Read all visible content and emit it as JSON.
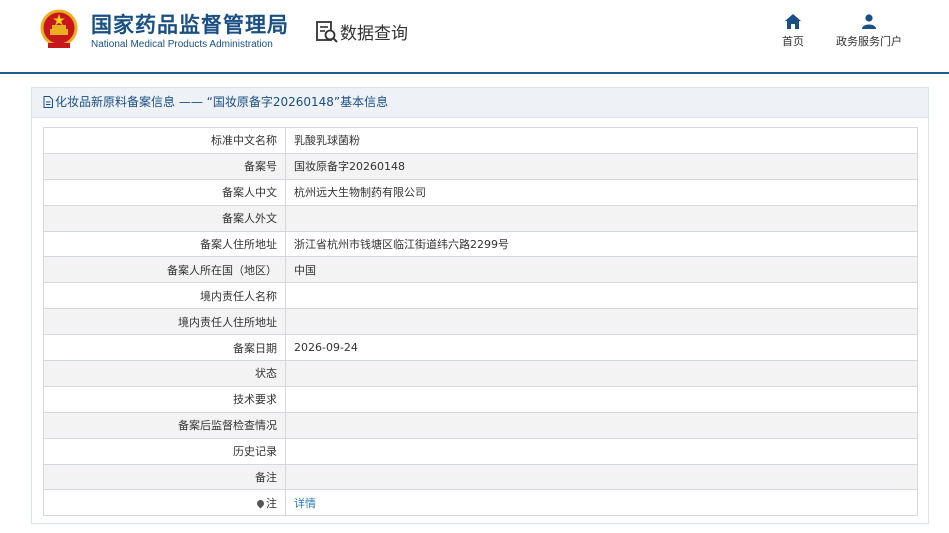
{
  "header": {
    "agency_cn": "国家药品监督管理局",
    "agency_en": "National Medical Products Administration",
    "query_title": "数据查询",
    "nav": [
      {
        "label": "首页",
        "icon": "home-icon"
      },
      {
        "label": "政务服务门户",
        "icon": "user-icon"
      }
    ]
  },
  "panel": {
    "title": "化妆品新原料备案信息 —— “国妆原备字20260148”基本信息",
    "rows": [
      {
        "label": "标准中文名称",
        "value": "乳酸乳球菌粉"
      },
      {
        "label": "备案号",
        "value": "国妆原备字20260148"
      },
      {
        "label": "备案人中文",
        "value": "杭州远大生物制药有限公司"
      },
      {
        "label": "备案人外文",
        "value": ""
      },
      {
        "label": "备案人住所地址",
        "value": "浙江省杭州市钱塘区临江街道纬六路2299号"
      },
      {
        "label": "备案人所在国（地区）",
        "value": "中国"
      },
      {
        "label": "境内责任人名称",
        "value": ""
      },
      {
        "label": "境内责任人住所地址",
        "value": ""
      },
      {
        "label": "备案日期",
        "value": "2026-09-24"
      },
      {
        "label": "状态",
        "value": ""
      },
      {
        "label": "技术要求",
        "value": ""
      },
      {
        "label": "备案后监督检查情况",
        "value": ""
      },
      {
        "label": "历史记录",
        "value": ""
      },
      {
        "label": "备注",
        "value": ""
      }
    ],
    "note_label": "注",
    "note_link": "详情"
  },
  "colors": {
    "brand": "#1a4f84",
    "header_line": "#1f5d8c",
    "link": "#2a7ab8"
  }
}
